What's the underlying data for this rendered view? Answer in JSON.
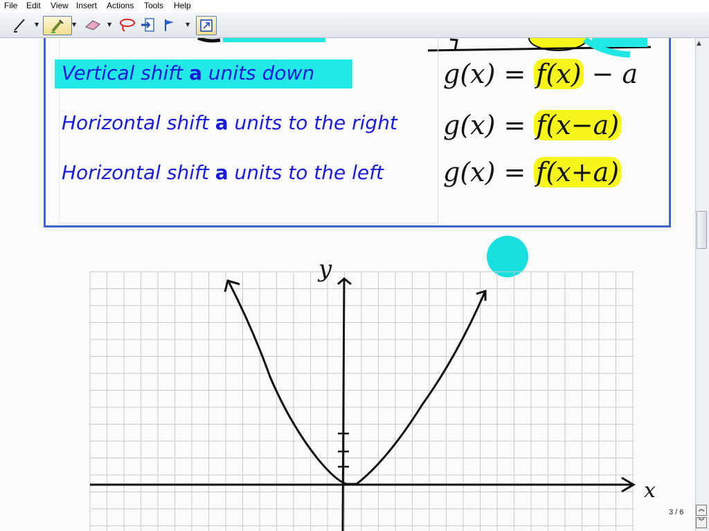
{
  "menu": [
    "File",
    "Edit",
    "View",
    "Insert",
    "Actions",
    "Tools",
    "Help"
  ],
  "toolbar": {
    "tools": [
      "pen-tool",
      "highlighter-tool",
      "eraser-tool",
      "lasso-tool",
      "insert-space-tool",
      "flag-tool",
      "fullscreen-tool"
    ]
  },
  "rules": [
    {
      "pre": "Vertical shift ",
      "param": "a",
      "post": " units down",
      "formula_lhs": "g(x) = ",
      "formula_hl": "f(x)",
      "formula_rhs": " − a"
    },
    {
      "pre": "Horizontal shift ",
      "param": "a",
      "post": " units to the right",
      "formula_lhs": "g(x) = ",
      "formula_hl": "f(x−a)",
      "formula_rhs": ""
    },
    {
      "pre": "Horizontal shift ",
      "param": "a",
      "post": " units to the left",
      "formula_lhs": "g(x) = ",
      "formula_hl": "f(x+a)",
      "formula_rhs": ""
    }
  ],
  "graph": {
    "x_label": "x",
    "y_label": "y"
  },
  "page_indicator": "3 / 6",
  "colors": {
    "text_blue": "#1a1adc",
    "box_border": "#3f64d2",
    "cyan_highlight": "#22e9e6",
    "yellow_highlight": "#f7f61a",
    "grid_line": "#c9c9c9"
  }
}
